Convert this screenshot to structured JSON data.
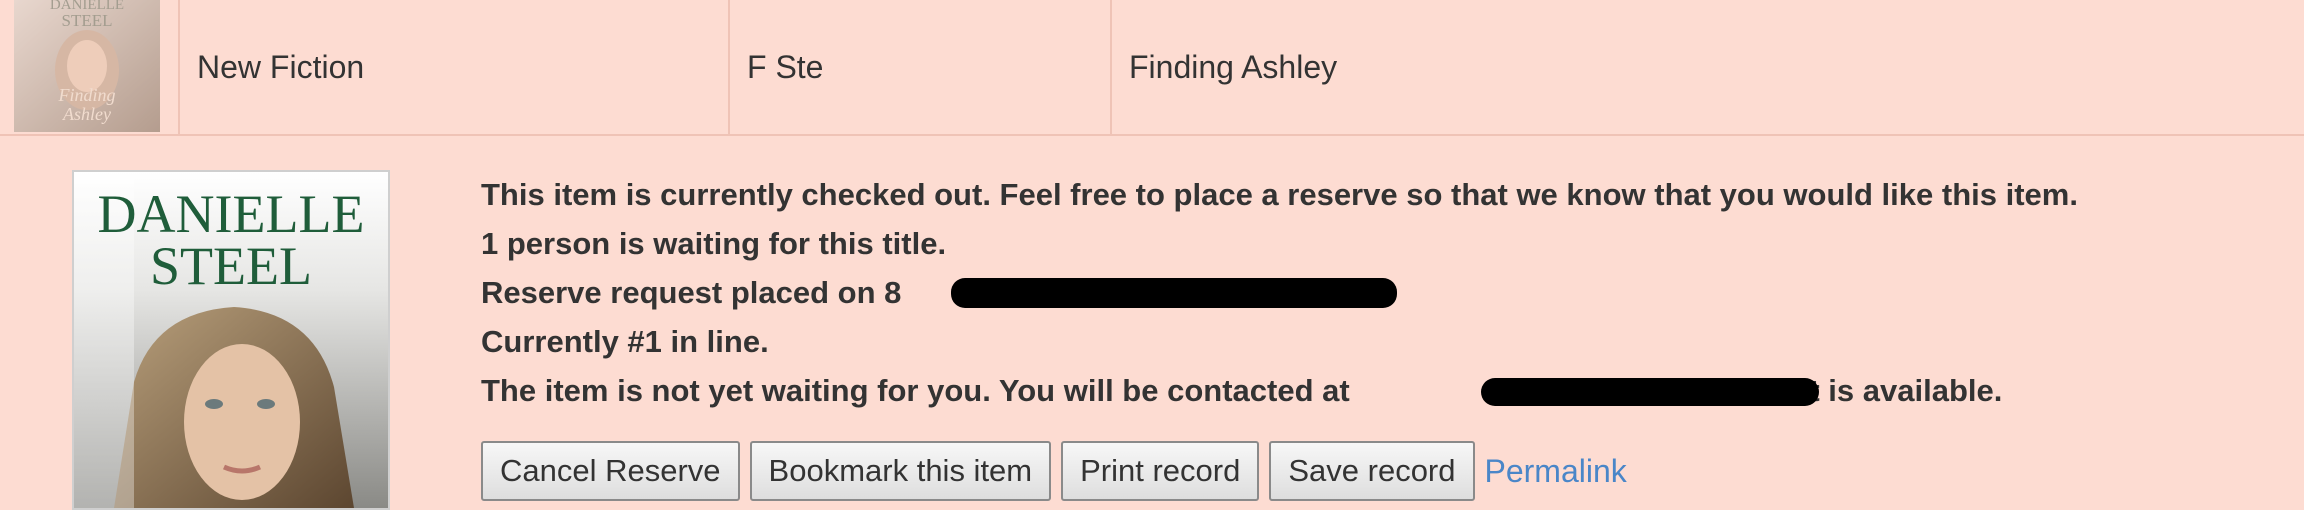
{
  "row": {
    "collection": "New Fiction",
    "call_number": "F Ste",
    "title": "Finding Ashley"
  },
  "cover": {
    "author_line1": "DANIELLE",
    "author_line2": "STEEL",
    "thumb_author_line1": "DANIELLE",
    "thumb_author_line2": "STEEL",
    "thumb_title_line1": "Finding",
    "thumb_title_line2": "Ashley"
  },
  "status": {
    "line1": "This item is currently checked out. Feel free to place a reserve so that we know that you would like this item.",
    "line2": "1 person is waiting for this title.",
    "line3_prefix": "Reserve request placed on 8",
    "line4": "Currently #1 in line.",
    "line5_prefix": "The item is not yet waiting for you. You will be contacted at ",
    "line5_suffix": " when it is available."
  },
  "actions": {
    "cancel_reserve": "Cancel Reserve",
    "bookmark": "Bookmark this item",
    "print": "Print record",
    "save": "Save record",
    "permalink": "Permalink"
  },
  "colors": {
    "background": "#fddcd2",
    "link": "#4a86c8",
    "cover_title": "#1f5d3a"
  }
}
